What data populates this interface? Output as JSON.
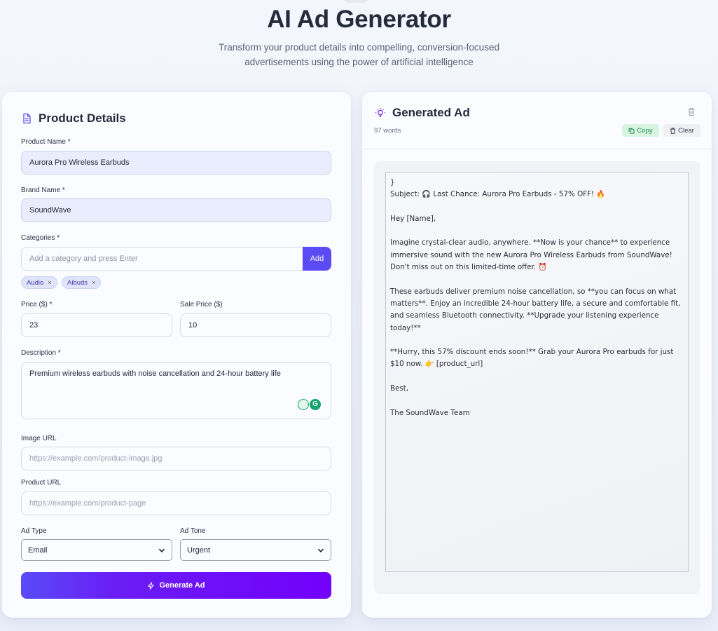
{
  "header": {
    "title": "AI Ad Generator",
    "subtitle": "Transform your product details into compelling, conversion-focused advertisements using the power of artificial intelligence"
  },
  "form": {
    "title": "Product Details",
    "icon": "document-icon",
    "product_name": {
      "label": "Product Name *",
      "value": "Aurora Pro Wireless Earbuds"
    },
    "brand_name": {
      "label": "Brand Name *",
      "value": "SoundWave"
    },
    "categories": {
      "label": "Categories *",
      "placeholder": "Add a category and press Enter",
      "add_label": "Add",
      "tags": [
        "Audio",
        "Aibuds"
      ]
    },
    "price": {
      "label": "Price ($) *",
      "value": "23"
    },
    "sale_price": {
      "label": "Sale Price ($)",
      "value": "10"
    },
    "description": {
      "label": "Description *",
      "value": "Premium wireless earbuds with noise cancellation and 24-hour battery life"
    },
    "image_url": {
      "label": "Image URL",
      "placeholder": "https://example.com/product-image.jpg"
    },
    "product_url": {
      "label": "Product URL",
      "placeholder": "https://example.com/product-page"
    },
    "ad_type": {
      "label": "Ad Type",
      "value": "Email"
    },
    "ad_tone": {
      "label": "Ad Tone",
      "value": "Urgent"
    },
    "generate_label": "Generate Ad"
  },
  "output": {
    "title": "Generated Ad",
    "icon": "lightbulb-icon",
    "word_count": "97 words",
    "copy_label": "Copy",
    "clear_label": "Clear",
    "text": "}\nSubject: 🎧 Last Chance: Aurora Pro Earbuds - 57% OFF! 🔥\n\nHey [Name],\n\nImagine crystal-clear audio, anywhere. **Now is your chance** to experience immersive sound with the new Aurora Pro Wireless Earbuds from SoundWave! Don't miss out on this limited-time offer. ⏰\n\nThese earbuds deliver premium noise cancellation, so **you can focus on what matters**. Enjoy an incredible 24-hour battery life, a secure and comfortable fit, and seamless Bluetooth connectivity. **Upgrade your listening experience today!**\n\n**Hurry, this 57% discount ends soon!** Grab your Aurora Pro earbuds for just $10 now. 👉 [product_url]\n\nBest,\n\nThe SoundWave Team"
  },
  "colors": {
    "accent": "#5b4bf5",
    "accent_end": "#7200fb",
    "copy_green": "#1c8a4b"
  }
}
